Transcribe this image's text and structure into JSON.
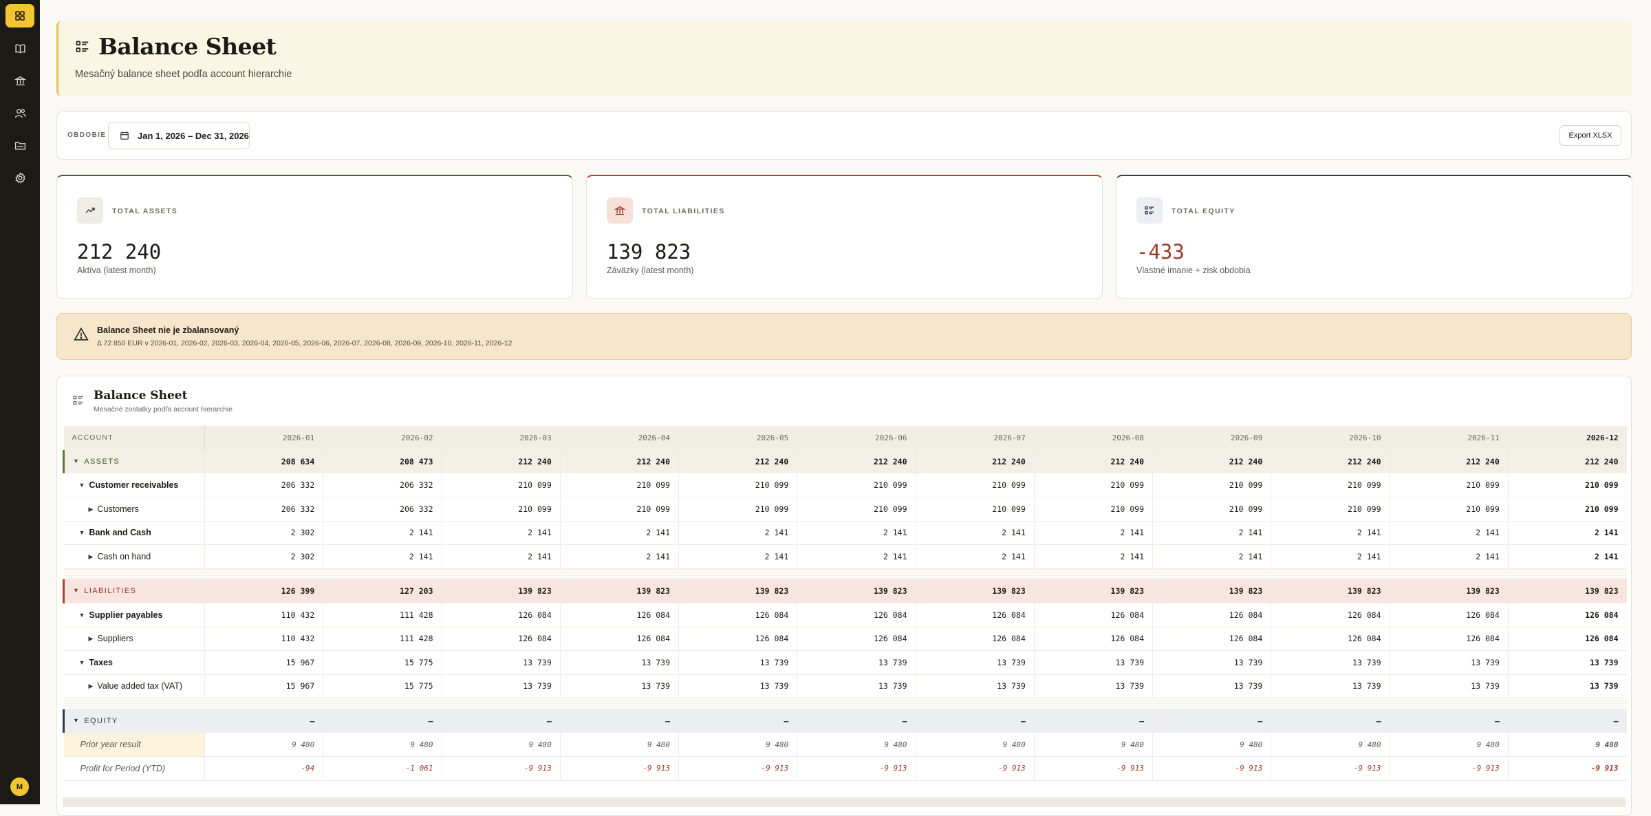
{
  "nav": {
    "items": [
      {
        "icon": "dashboard-icon",
        "active": true
      },
      {
        "icon": "book-icon",
        "active": false
      },
      {
        "icon": "bank-icon",
        "active": false
      },
      {
        "icon": "users-icon",
        "active": false
      },
      {
        "icon": "folder-icon",
        "active": false
      },
      {
        "icon": "gear-icon",
        "active": false
      }
    ],
    "avatar": "M"
  },
  "header": {
    "title": "Balance Sheet",
    "subtitle": "Mesačný balance sheet podľa account hierarchie"
  },
  "filters": {
    "period_label": "OBDOBIE",
    "period_value": "Jan 1, 2026 – Dec 31, 2026",
    "export_label": "Export XLSX"
  },
  "kpis": [
    {
      "label": "TOTAL ASSETS",
      "value": "212 240",
      "sub": "Aktíva (latest month)",
      "accent": "#4a5d36",
      "value_color": "#1c1a16"
    },
    {
      "label": "TOTAL LIABILITIES",
      "value": "139 823",
      "sub": "Záväzky (latest month)",
      "accent": "#b0402a",
      "value_color": "#1c1a16"
    },
    {
      "label": "TOTAL EQUITY",
      "value": "-433",
      "sub": "Vlastné imanie + zisk obdobia",
      "accent": "#2d3a4c",
      "value_color": "#9a3c2a"
    }
  ],
  "alert": {
    "title": "Balance Sheet nie je zbalansovaný",
    "text": "Δ 72 850 EUR v 2026-01, 2026-02, 2026-03, 2026-04, 2026-05, 2026-06, 2026-07, 2026-08, 2026-09, 2026-10, 2026-11, 2026-12"
  },
  "table": {
    "title": "Balance Sheet",
    "subtitle": "Mesačné zostatky podľa account hierarchie",
    "account_header": "ACCOUNT",
    "months": [
      "2026-01",
      "2026-02",
      "2026-03",
      "2026-04",
      "2026-05",
      "2026-06",
      "2026-07",
      "2026-08",
      "2026-09",
      "2026-10",
      "2026-11",
      "2026-12"
    ],
    "rows": [
      {
        "kind": "sec-assets",
        "label": "ASSETS",
        "values": [
          "208 634",
          "208 473",
          "212 240",
          "212 240",
          "212 240",
          "212 240",
          "212 240",
          "212 240",
          "212 240",
          "212 240",
          "212 240",
          "212 240"
        ]
      },
      {
        "kind": "grp",
        "label": "Customer receivables",
        "values": [
          "206 332",
          "206 332",
          "210 099",
          "210 099",
          "210 099",
          "210 099",
          "210 099",
          "210 099",
          "210 099",
          "210 099",
          "210 099",
          "210 099"
        ]
      },
      {
        "kind": "leaf",
        "label": "Customers",
        "values": [
          "206 332",
          "206 332",
          "210 099",
          "210 099",
          "210 099",
          "210 099",
          "210 099",
          "210 099",
          "210 099",
          "210 099",
          "210 099",
          "210 099"
        ]
      },
      {
        "kind": "grp",
        "label": "Bank and Cash",
        "values": [
          "2 302",
          "2 141",
          "2 141",
          "2 141",
          "2 141",
          "2 141",
          "2 141",
          "2 141",
          "2 141",
          "2 141",
          "2 141",
          "2 141"
        ]
      },
      {
        "kind": "leaf",
        "label": "Cash on hand",
        "values": [
          "2 302",
          "2 141",
          "2 141",
          "2 141",
          "2 141",
          "2 141",
          "2 141",
          "2 141",
          "2 141",
          "2 141",
          "2 141",
          "2 141"
        ]
      },
      {
        "kind": "spacer"
      },
      {
        "kind": "sec-liab",
        "label": "LIABILITIES",
        "values": [
          "126 399",
          "127 203",
          "139 823",
          "139 823",
          "139 823",
          "139 823",
          "139 823",
          "139 823",
          "139 823",
          "139 823",
          "139 823",
          "139 823"
        ]
      },
      {
        "kind": "grp",
        "label": "Supplier payables",
        "values": [
          "110 432",
          "111 428",
          "126 084",
          "126 084",
          "126 084",
          "126 084",
          "126 084",
          "126 084",
          "126 084",
          "126 084",
          "126 084",
          "126 084"
        ]
      },
      {
        "kind": "leaf",
        "label": "Suppliers",
        "values": [
          "110 432",
          "111 428",
          "126 084",
          "126 084",
          "126 084",
          "126 084",
          "126 084",
          "126 084",
          "126 084",
          "126 084",
          "126 084",
          "126 084"
        ]
      },
      {
        "kind": "grp",
        "label": "Taxes",
        "values": [
          "15 967",
          "15 775",
          "13 739",
          "13 739",
          "13 739",
          "13 739",
          "13 739",
          "13 739",
          "13 739",
          "13 739",
          "13 739",
          "13 739"
        ]
      },
      {
        "kind": "leaf",
        "label": "Value added tax (VAT)",
        "values": [
          "15 967",
          "15 775",
          "13 739",
          "13 739",
          "13 739",
          "13 739",
          "13 739",
          "13 739",
          "13 739",
          "13 739",
          "13 739",
          "13 739"
        ]
      },
      {
        "kind": "spacer"
      },
      {
        "kind": "sec-eq",
        "label": "EQUITY",
        "values": [
          "—",
          "—",
          "—",
          "—",
          "—",
          "—",
          "—",
          "—",
          "—",
          "—",
          "—",
          "—"
        ]
      },
      {
        "kind": "it it-py",
        "label": "Prior year result",
        "values": [
          "9 480",
          "9 480",
          "9 480",
          "9 480",
          "9 480",
          "9 480",
          "9 480",
          "9 480",
          "9 480",
          "9 480",
          "9 480",
          "9 480"
        ]
      },
      {
        "kind": "it it-pl",
        "label": "Profit for Period (YTD)",
        "values": [
          "-94",
          "-1 061",
          "-9 913",
          "-9 913",
          "-9 913",
          "-9 913",
          "-9 913",
          "-9 913",
          "-9 913",
          "-9 913",
          "-9 913",
          "-9 913"
        ]
      }
    ]
  }
}
